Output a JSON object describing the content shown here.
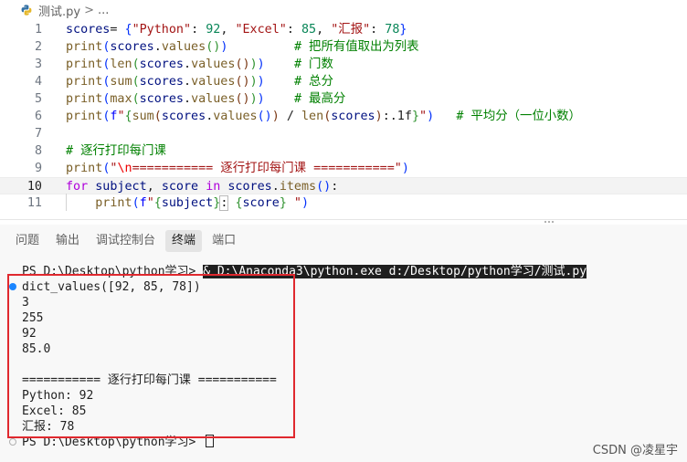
{
  "breadcrumb": {
    "file": "测试.py",
    "separator": ">",
    "more": "..."
  },
  "editor": {
    "lines": [
      {
        "num": "1",
        "parts": [
          [
            "var",
            "scores"
          ],
          [
            "",
            "= "
          ],
          [
            "br1",
            "{"
          ],
          [
            "str",
            "\"Python\""
          ],
          [
            "",
            ": "
          ],
          [
            "num",
            "92"
          ],
          [
            "",
            ", "
          ],
          [
            "str",
            "\"Excel\""
          ],
          [
            "",
            ": "
          ],
          [
            "num",
            "85"
          ],
          [
            "",
            ", "
          ],
          [
            "str",
            "\"汇报\""
          ],
          [
            "",
            ": "
          ],
          [
            "num",
            "78"
          ],
          [
            "br1",
            "}"
          ]
        ]
      },
      {
        "num": "2",
        "parts": [
          [
            "fn",
            "print"
          ],
          [
            "br1",
            "("
          ],
          [
            "var",
            "scores"
          ],
          [
            "",
            "."
          ],
          [
            "fn",
            "values"
          ],
          [
            "br2",
            "()"
          ],
          [
            "br1",
            ")"
          ],
          [
            "",
            "         "
          ],
          [
            "cmt",
            "# 把所有值取出为列表"
          ]
        ]
      },
      {
        "num": "3",
        "parts": [
          [
            "fn",
            "print"
          ],
          [
            "br1",
            "("
          ],
          [
            "fn",
            "len"
          ],
          [
            "br2",
            "("
          ],
          [
            "var",
            "scores"
          ],
          [
            "",
            "."
          ],
          [
            "fn",
            "values"
          ],
          [
            "br3",
            "()"
          ],
          [
            "br2",
            ")"
          ],
          [
            "br1",
            ")"
          ],
          [
            "",
            "    "
          ],
          [
            "cmt",
            "# 门数"
          ]
        ]
      },
      {
        "num": "4",
        "parts": [
          [
            "fn",
            "print"
          ],
          [
            "br1",
            "("
          ],
          [
            "fn",
            "sum"
          ],
          [
            "br2",
            "("
          ],
          [
            "var",
            "scores"
          ],
          [
            "",
            "."
          ],
          [
            "fn",
            "values"
          ],
          [
            "br3",
            "()"
          ],
          [
            "br2",
            ")"
          ],
          [
            "br1",
            ")"
          ],
          [
            "",
            "    "
          ],
          [
            "cmt",
            "# 总分"
          ]
        ]
      },
      {
        "num": "5",
        "parts": [
          [
            "fn",
            "print"
          ],
          [
            "br1",
            "("
          ],
          [
            "fn",
            "max"
          ],
          [
            "br2",
            "("
          ],
          [
            "var",
            "scores"
          ],
          [
            "",
            "."
          ],
          [
            "fn",
            "values"
          ],
          [
            "br3",
            "()"
          ],
          [
            "br2",
            ")"
          ],
          [
            "br1",
            ")"
          ],
          [
            "",
            "    "
          ],
          [
            "cmt",
            "# 最高分"
          ]
        ]
      },
      {
        "num": "6",
        "parts": [
          [
            "fn",
            "print"
          ],
          [
            "br1",
            "("
          ],
          [
            "fx",
            "f"
          ],
          [
            "str",
            "\""
          ],
          [
            "br2",
            "{"
          ],
          [
            "fn",
            "sum"
          ],
          [
            "br3",
            "("
          ],
          [
            "var",
            "scores"
          ],
          [
            "",
            "."
          ],
          [
            "fn",
            "values"
          ],
          [
            "br1",
            "()"
          ],
          [
            "br3",
            ")"
          ],
          [
            "",
            ""
          ],
          [
            "",
            " / "
          ],
          [
            "fn",
            "len"
          ],
          [
            "br3",
            "("
          ],
          [
            "var",
            "scores"
          ],
          [
            "br3",
            ")"
          ],
          [
            "",
            ":.1f"
          ],
          [
            "br2",
            "}"
          ],
          [
            "str",
            "\""
          ],
          [
            "br1",
            ")"
          ],
          [
            "",
            "   "
          ],
          [
            "cmt",
            "# 平均分（一位小数）"
          ]
        ]
      },
      {
        "num": "7",
        "parts": []
      },
      {
        "num": "8",
        "parts": [
          [
            "cmt",
            "# 逐行打印每门课"
          ]
        ]
      },
      {
        "num": "9",
        "parts": [
          [
            "fn",
            "print"
          ],
          [
            "br1",
            "("
          ],
          [
            "str",
            "\""
          ],
          [
            "esc",
            "\\n"
          ],
          [
            "str",
            "=========== 逐行打印每门课 ===========\""
          ],
          [
            "br1",
            ")"
          ]
        ]
      },
      {
        "num": "10",
        "active": true,
        "parts": [
          [
            "kw",
            "for"
          ],
          [
            "",
            " "
          ],
          [
            "var",
            "subject"
          ],
          [
            "",
            ", "
          ],
          [
            "var",
            "score"
          ],
          [
            "",
            " "
          ],
          [
            "kw",
            "in"
          ],
          [
            "",
            " "
          ],
          [
            "var",
            "scores"
          ],
          [
            "",
            "."
          ],
          [
            "fn",
            "items"
          ],
          [
            "br1",
            "()"
          ],
          [
            "",
            ":"
          ]
        ]
      },
      {
        "num": "11",
        "parts": [
          [
            "",
            "    "
          ],
          [
            "fn",
            "print"
          ],
          [
            "br1",
            "("
          ],
          [
            "fx",
            "f"
          ],
          [
            "str",
            "\""
          ],
          [
            "br2",
            "{"
          ],
          [
            "var",
            "subject"
          ],
          [
            "br2",
            "}"
          ],
          [
            "caret",
            ":"
          ],
          [
            "str",
            " "
          ],
          [
            "br2",
            "{"
          ],
          [
            "var",
            "score"
          ],
          [
            "br2",
            "}"
          ],
          [
            "str",
            " \""
          ],
          [
            "br1",
            ")"
          ]
        ]
      }
    ]
  },
  "panel": {
    "tabs": [
      {
        "label": "问题",
        "active": false
      },
      {
        "label": "输出",
        "active": false
      },
      {
        "label": "调试控制台",
        "active": false
      },
      {
        "label": "终端",
        "active": true
      },
      {
        "label": "端口",
        "active": false
      }
    ]
  },
  "terminal": {
    "command_prompt": "PS D:\\Desktop\\python学习> ",
    "command_run": "& D:\\Anaconda3\\python.exe d:/Desktop/python学习/测试.py",
    "output": [
      "dict_values([92, 85, 78])",
      "3",
      "255",
      "92",
      "85.0",
      "",
      "=========== 逐行打印每门课 ===========",
      "Python: 92",
      "Excel: 85",
      "汇报: 78"
    ],
    "final_prompt": "PS D:\\Desktop\\python学习> "
  },
  "watermark": "CSDN @凌星宇",
  "colors": {
    "highlight_box": "#e0282e",
    "accent_blue": "#1a85ff"
  }
}
